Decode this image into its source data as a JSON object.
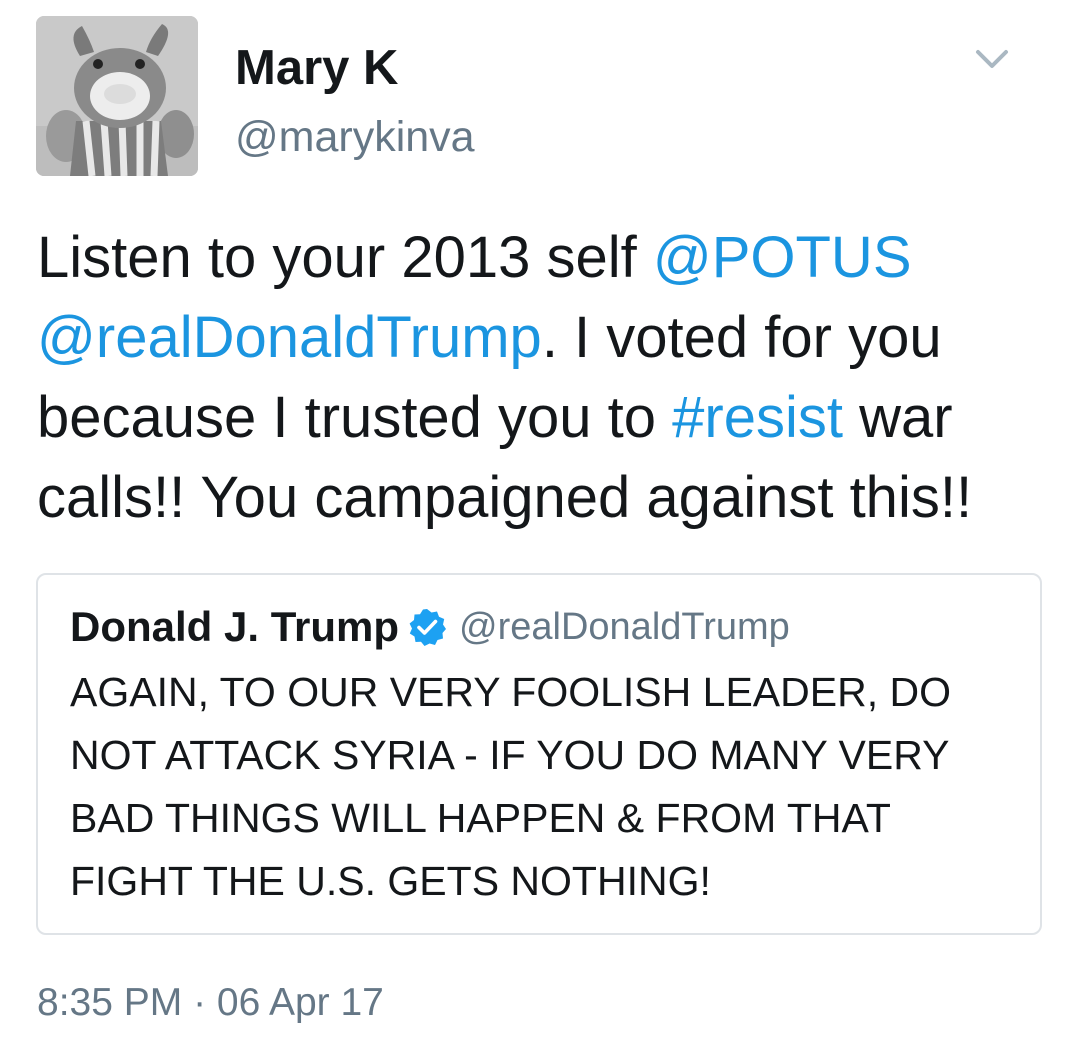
{
  "author": {
    "display_name": "Mary K",
    "handle": "@marykinva"
  },
  "tweet": {
    "segments": [
      {
        "text": "Listen to your 2013 self ",
        "link": false
      },
      {
        "text": "@POTUS",
        "link": true
      },
      {
        "text": " ",
        "link": false
      },
      {
        "text": "@realDonaldTrump",
        "link": true
      },
      {
        "text": ". I voted for you because I trusted you to ",
        "link": false
      },
      {
        "text": "#resist",
        "link": true
      },
      {
        "text": " war calls!! You campaigned against this!!",
        "link": false
      }
    ],
    "timestamp": "8:35 PM · 06 Apr 17"
  },
  "quoted_tweet": {
    "display_name": "Donald J. Trump",
    "handle": "@realDonaldTrump",
    "text": "AGAIN, TO OUR VERY FOOLISH LEADER, DO NOT ATTACK SYRIA - IF YOU DO MANY VERY BAD THINGS WILL HAPPEN & FROM THAT FIGHT THE U.S. GETS NOTHING!"
  },
  "icons": {
    "avatar": "plush-toy-avatar",
    "menu": "chevron-down-icon",
    "verified": "verified-badge-icon"
  },
  "colors": {
    "link": "#1b95e0",
    "secondary_text": "#657786",
    "primary_text": "#14171a",
    "verified": "#1da1f2",
    "border": "#dfe3e7"
  }
}
